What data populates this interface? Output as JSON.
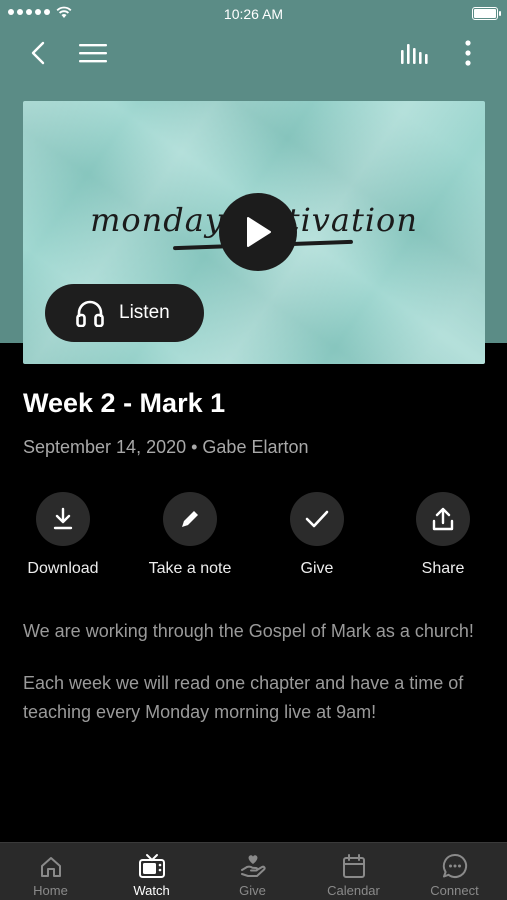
{
  "status_bar": {
    "time": "10:26 AM"
  },
  "media": {
    "artwork_text": "monday motivation",
    "listen_label": "Listen"
  },
  "sermon": {
    "title": "Week 2 - Mark 1",
    "meta": "September 14, 2020 • Gabe Elarton"
  },
  "actions": [
    {
      "label": "Download",
      "icon": "download-icon"
    },
    {
      "label": "Take a note",
      "icon": "pencil-icon"
    },
    {
      "label": "Give",
      "icon": "check-icon"
    },
    {
      "label": "Share",
      "icon": "share-icon"
    }
  ],
  "description": [
    "We are working through the Gospel of Mark as a church!",
    "Each week we will read one chapter and have a time of teaching every Monday morning live at 9am!"
  ],
  "tabs": [
    {
      "label": "Home",
      "icon": "home-icon",
      "active": false
    },
    {
      "label": "Watch",
      "icon": "tv-icon",
      "active": true
    },
    {
      "label": "Give",
      "icon": "give-hand-icon",
      "active": false
    },
    {
      "label": "Calendar",
      "icon": "calendar-icon",
      "active": false
    },
    {
      "label": "Connect",
      "icon": "chat-icon",
      "active": false
    }
  ],
  "colors": {
    "header_bg": "#5b8c86",
    "artwork_bg": "#8ed0c8",
    "page_bg": "#000000",
    "tab_bar_bg": "#2a2a2a"
  }
}
